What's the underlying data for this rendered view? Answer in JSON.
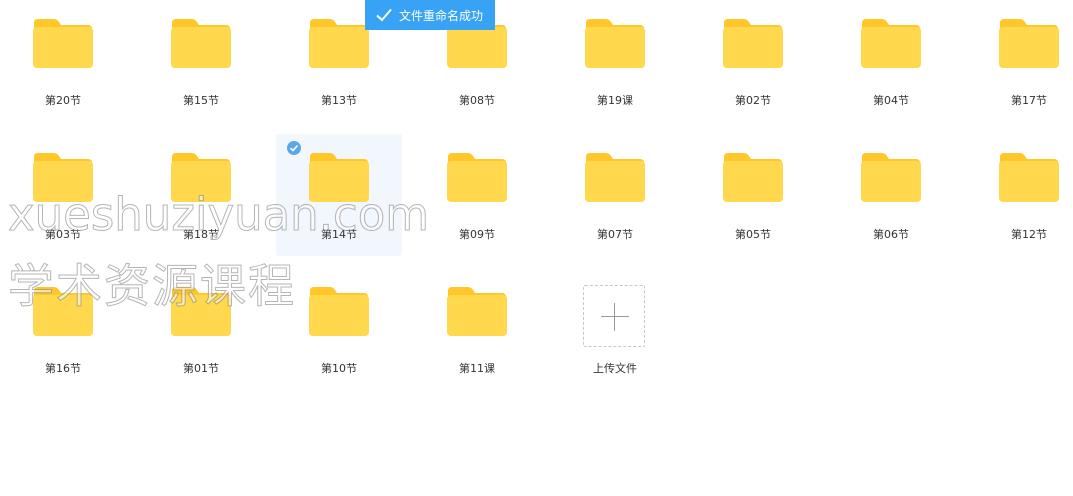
{
  "toast": {
    "text": "文件重命名成功",
    "color": "#38a3f5"
  },
  "folders": [
    {
      "label": "第20节"
    },
    {
      "label": "第15节"
    },
    {
      "label": "第13节"
    },
    {
      "label": "第08节"
    },
    {
      "label": "第19课"
    },
    {
      "label": "第02节"
    },
    {
      "label": "第04节"
    },
    {
      "label": "第17节"
    },
    {
      "label": "第03节"
    },
    {
      "label": "第18节"
    },
    {
      "label": "第14节",
      "selected": true
    },
    {
      "label": "第09节"
    },
    {
      "label": "第07节"
    },
    {
      "label": "第05节"
    },
    {
      "label": "第06节"
    },
    {
      "label": "第12节"
    },
    {
      "label": "第16节"
    },
    {
      "label": "第01节"
    },
    {
      "label": "第10节"
    },
    {
      "label": "第11课"
    }
  ],
  "upload": {
    "label": "上传文件",
    "icon": "plus-icon"
  },
  "watermark": {
    "line1": "xueshuziyuan.com",
    "line2": "学术资源课程"
  },
  "colors": {
    "folder_body": "#ffd84e",
    "folder_tab": "#ffc729",
    "selected_bg": "#f1f7fd",
    "check": "#5aa7ea"
  }
}
